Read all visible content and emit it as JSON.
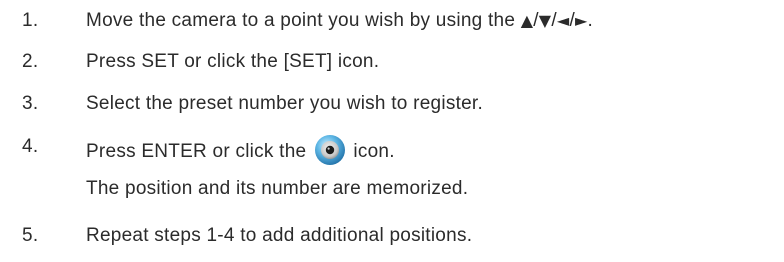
{
  "steps": [
    {
      "number": "1.",
      "text_before": "Move the camera to a point you wish by using the ",
      "arrow_up": "▲",
      "sep1": "/",
      "arrow_down": "▼",
      "sep2": "/",
      "arrow_left": "◄",
      "sep3": "/",
      "arrow_right": "►",
      "text_after": "."
    },
    {
      "number": "2.",
      "text": "Press SET or click the [SET] icon."
    },
    {
      "number": "3.",
      "text": "Select the preset number you wish to register."
    },
    {
      "number": "4.",
      "text_before": "Press ENTER or click the ",
      "icon": "enter-icon",
      "text_after": " icon.",
      "subtext": "The position and its number are memorized."
    },
    {
      "number": "5.",
      "text": "Repeat steps 1-4 to add additional positions."
    }
  ],
  "colors": {
    "text": "#2b2b2b",
    "icon_ring": "#4aa3d8",
    "icon_center": "#1b1b1b"
  }
}
